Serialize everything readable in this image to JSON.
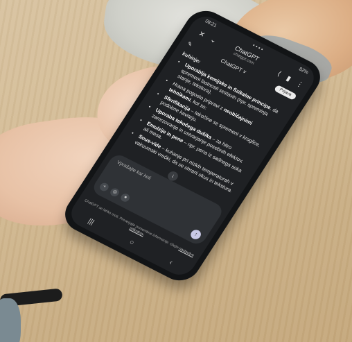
{
  "statusbar": {
    "time": "08:21",
    "icons": "▪ ▪ ▪ ▪",
    "battery": "82%"
  },
  "browser": {
    "title": "ChatGPT",
    "url": "chatgpt.com"
  },
  "chat": {
    "model": "ChatGPT ˅",
    "login": "Prijava"
  },
  "message": {
    "heading": "kuhinje:",
    "items": [
      {
        "lead": "Uporablja kemijske in fizikalne principe",
        "rest": ", da spremeni lastnosti sestavin (npr. spreminja stanje, tekstura)."
      },
      {
        "lead": "",
        "rest": "Hrana pogosto pripravi z ",
        "tail": "neobičajnimi tehnikami",
        "end": ", kot so:"
      },
      {
        "lead": "Sferifikacija",
        "rest": " – tekočine se spremeni v kroglice, podobne kaviarju."
      },
      {
        "lead": "Uporaba tekočega dušika",
        "rest": " – za hitro zamrzovanje in ustvarjanje posebnih efektov."
      },
      {
        "lead": "Emulzije in pene",
        "rest": " – npr. pena iz sadnega soka ali mesa."
      },
      {
        "lead": "Sous-vide",
        "rest": " – kuhanje pri nizkih temperaturah v vakuumski vrečki, da se ohrani okus in tekstura."
      }
    ]
  },
  "composer": {
    "placeholder": "Vprašajte kar koli"
  },
  "footer": {
    "text": "ChatGPT se lahko moti. Preverjajte pomembne informacije. Glejte",
    "link": "nastavitve piškotkov."
  },
  "icons": {
    "close": "✕",
    "chevron": "⌄",
    "share": "⟨",
    "bookmark": "▮",
    "menu": "⋮",
    "edit": "✎",
    "attach": "+",
    "globe": "◎",
    "mic": "●",
    "send": "↑",
    "scroll_down": "↓",
    "nav_recent": "|||",
    "nav_home": "○",
    "nav_back": "‹"
  }
}
